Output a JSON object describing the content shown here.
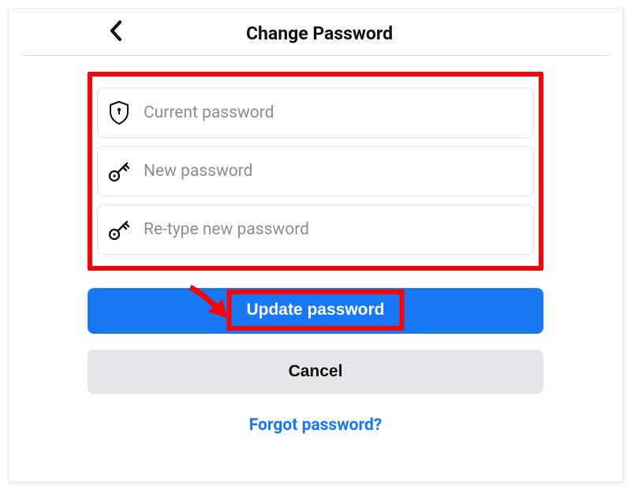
{
  "header": {
    "title": "Change Password"
  },
  "inputs": {
    "current": {
      "placeholder": "Current password"
    },
    "new": {
      "placeholder": "New password"
    },
    "retype": {
      "placeholder": "Re-type new password"
    }
  },
  "buttons": {
    "update": "Update password",
    "cancel": "Cancel"
  },
  "links": {
    "forgot": "Forgot password?"
  },
  "colors": {
    "primary": "#1877f2",
    "highlight": "#fb0202",
    "muted": "#8a8d91",
    "secondary_bg": "#e5e6ea"
  }
}
